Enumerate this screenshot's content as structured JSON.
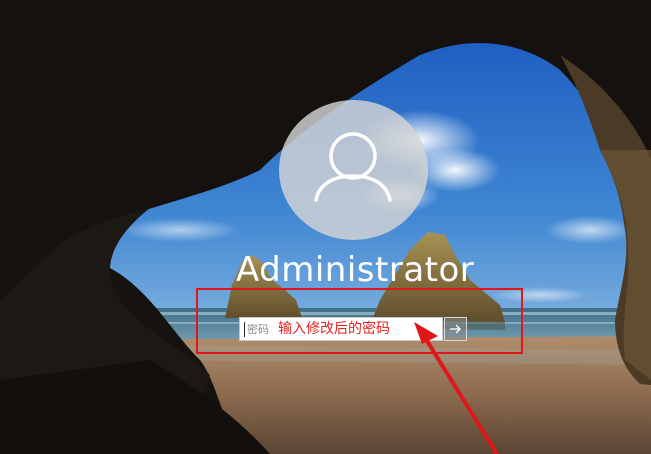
{
  "login": {
    "username": "Administrator",
    "password_placeholder": "密码",
    "password_annotation": "输入修改后的密码"
  },
  "colors": {
    "annotation_red": "#e0161a",
    "avatar_bg": "#d4d4d4",
    "field_bg": "#ffffff"
  },
  "icons": {
    "avatar": "user-silhouette-icon",
    "submit": "arrow-right-icon"
  }
}
